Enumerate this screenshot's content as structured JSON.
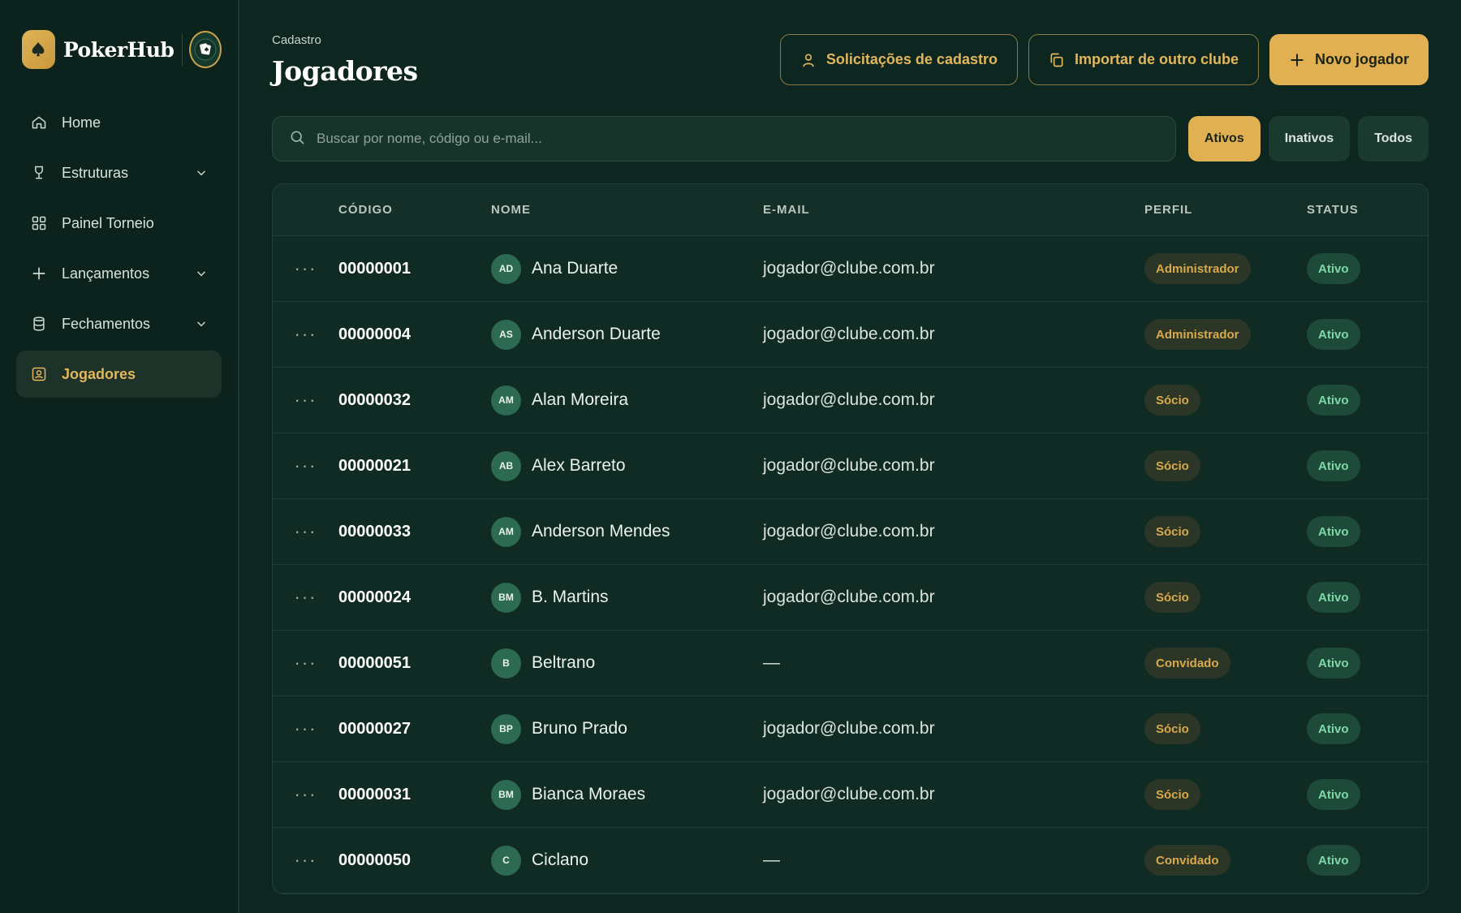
{
  "brand": {
    "name": "PokerHub"
  },
  "nav": [
    {
      "label": "Home",
      "icon": "home-icon",
      "expandable": false,
      "active": false
    },
    {
      "label": "Estruturas",
      "icon": "trophy-icon",
      "expandable": true,
      "active": false
    },
    {
      "label": "Painel Torneio",
      "icon": "grid-icon",
      "expandable": false,
      "active": false
    },
    {
      "label": "Lançamentos",
      "icon": "plus-icon",
      "expandable": true,
      "active": false
    },
    {
      "label": "Fechamentos",
      "icon": "database-icon",
      "expandable": true,
      "active": false
    },
    {
      "label": "Jogadores",
      "icon": "player-card-icon",
      "expandable": false,
      "active": true
    }
  ],
  "header": {
    "breadcrumb": "Cadastro",
    "title": "Jogadores",
    "actions": {
      "requests": "Solicitações de cadastro",
      "import": "Importar de outro clube",
      "new_player": "Novo jogador"
    }
  },
  "search": {
    "placeholder": "Buscar por nome, código ou e-mail..."
  },
  "filters": [
    {
      "label": "Ativos",
      "active": true
    },
    {
      "label": "Inativos",
      "active": false
    },
    {
      "label": "Todos",
      "active": false
    }
  ],
  "table": {
    "columns": {
      "code": "CÓDIGO",
      "name": "NOME",
      "email": "E-MAIL",
      "perfil": "PERFIL",
      "status": "STATUS"
    },
    "rows": [
      {
        "code": "00000001",
        "initials": "AD",
        "name": "Ana Duarte",
        "email": "jogador@clube.com.br",
        "perfil": "Administrador",
        "status": "Ativo"
      },
      {
        "code": "00000004",
        "initials": "AS",
        "name": "Anderson Duarte",
        "email": "jogador@clube.com.br",
        "perfil": "Administrador",
        "status": "Ativo"
      },
      {
        "code": "00000032",
        "initials": "AM",
        "name": "Alan Moreira",
        "email": "jogador@clube.com.br",
        "perfil": "Sócio",
        "status": "Ativo"
      },
      {
        "code": "00000021",
        "initials": "AB",
        "name": "Alex Barreto",
        "email": "jogador@clube.com.br",
        "perfil": "Sócio",
        "status": "Ativo"
      },
      {
        "code": "00000033",
        "initials": "AM",
        "name": "Anderson Mendes",
        "email": "jogador@clube.com.br",
        "perfil": "Sócio",
        "status": "Ativo"
      },
      {
        "code": "00000024",
        "initials": "BM",
        "name": "B. Martins",
        "email": "jogador@clube.com.br",
        "perfil": "Sócio",
        "status": "Ativo"
      },
      {
        "code": "00000051",
        "initials": "B",
        "name": "Beltrano",
        "email": "—",
        "perfil": "Convidado",
        "status": "Ativo"
      },
      {
        "code": "00000027",
        "initials": "BP",
        "name": "Bruno Prado",
        "email": "jogador@clube.com.br",
        "perfil": "Sócio",
        "status": "Ativo"
      },
      {
        "code": "00000031",
        "initials": "BM",
        "name": "Bianca Moraes",
        "email": "jogador@clube.com.br",
        "perfil": "Sócio",
        "status": "Ativo"
      },
      {
        "code": "00000050",
        "initials": "C",
        "name": "Ciclano",
        "email": "—",
        "perfil": "Convidado",
        "status": "Ativo"
      }
    ]
  },
  "colors": {
    "accent": "#e0b052",
    "background": "#0d2720",
    "status_green": "#7fd8a8"
  }
}
